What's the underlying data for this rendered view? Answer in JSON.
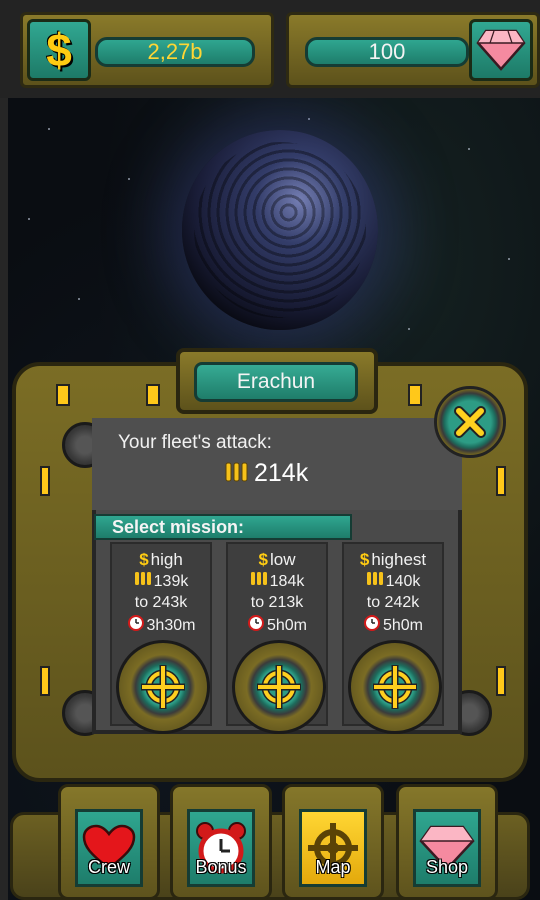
{
  "resources": {
    "money": {
      "value": "2,27b",
      "icon": "dollar-icon"
    },
    "gems": {
      "value": "100",
      "icon": "gem-icon"
    }
  },
  "planet": {
    "name": "Erachun"
  },
  "fleet": {
    "attack_label": "Your fleet's attack:",
    "attack_value": "214k"
  },
  "mission_header": "Select mission:",
  "missions": [
    {
      "reward": "high",
      "power_min": "139k",
      "power_max": "to 243k",
      "duration": "3h30m"
    },
    {
      "reward": "low",
      "power_min": "184k",
      "power_max": "to 213k",
      "duration": "5h0m"
    },
    {
      "reward": "highest",
      "power_min": "140k",
      "power_max": "to 242k",
      "duration": "5h0m"
    }
  ],
  "nav": [
    {
      "label": "Crew",
      "icon": "heart-icon"
    },
    {
      "label": "Bonus",
      "icon": "alarm-clock-icon"
    },
    {
      "label": "Map",
      "icon": "crosshair-icon",
      "active": true
    },
    {
      "label": "Shop",
      "icon": "gem-icon"
    }
  ],
  "colors": {
    "teal": "#2fa690",
    "gold": "#ffcc12",
    "olive": "#7b6d25",
    "gem": "#f58aa0"
  }
}
